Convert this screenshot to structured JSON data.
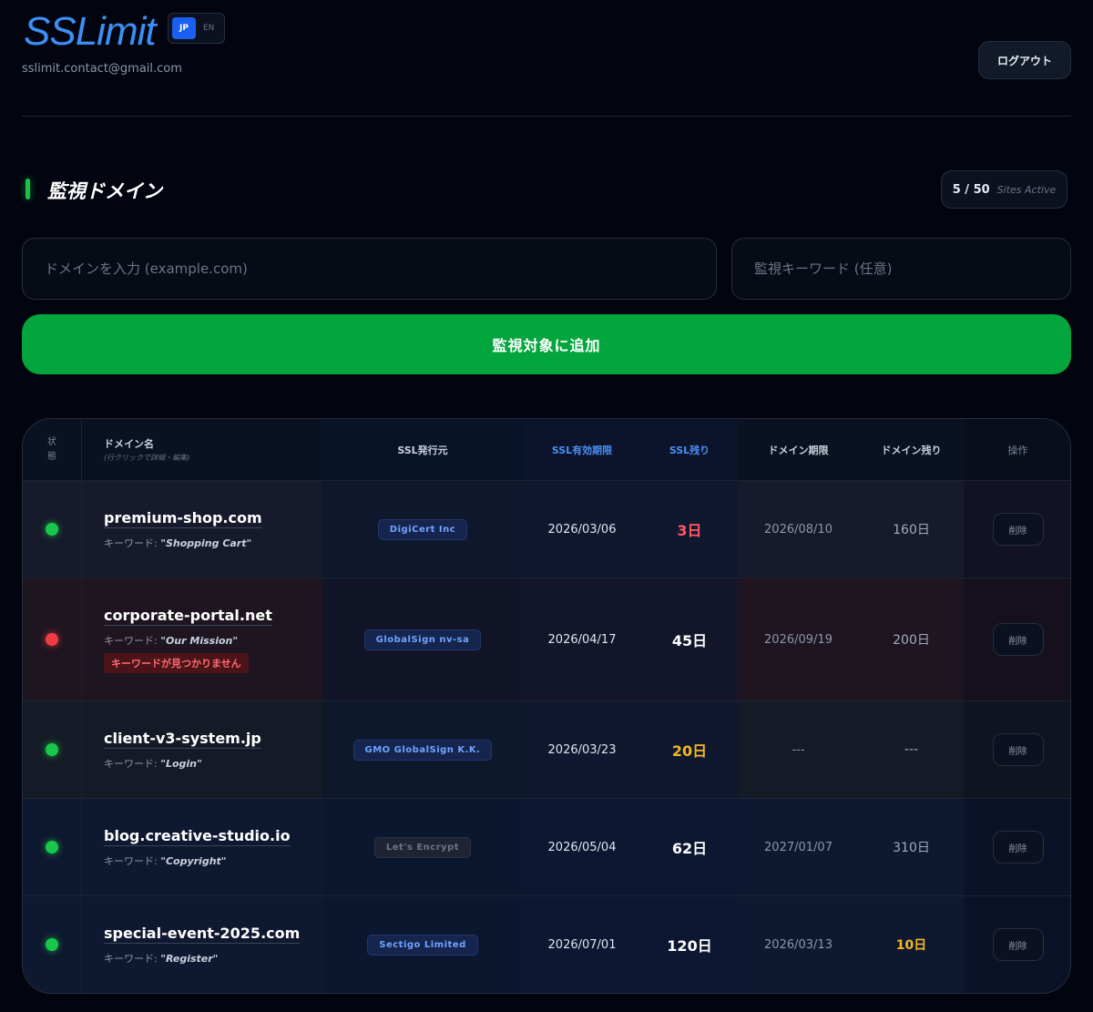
{
  "header": {
    "logo": "SSLimit",
    "lang": {
      "jp": "JP",
      "en": "EN"
    },
    "email": "sslimit.contact@gmail.com",
    "logout_label": "ログアウト"
  },
  "section": {
    "title": "監視ドメイン",
    "sites_count": "5 / 50",
    "sites_label": "Sites Active"
  },
  "form": {
    "domain_placeholder": "ドメインを入力 (example.com)",
    "keyword_placeholder": "監視キーワード (任意)",
    "add_label": "監視対象に追加"
  },
  "table": {
    "headers": {
      "status_1": "状",
      "status_2": "態",
      "domain": "ドメイン名",
      "domain_sub": "(行クリックで詳細・編集)",
      "issuer": "SSL発行元",
      "ssl_expiry": "SSL有効期限",
      "ssl_remaining": "SSL残り",
      "domain_expiry": "ドメイン期限",
      "domain_remaining": "ドメイン残り",
      "ops": "操作"
    },
    "keyword_prefix": "キーワード:",
    "delete_label": "削除",
    "rows": [
      {
        "domain": "premium-shop.com",
        "keyword": "\"Shopping Cart\"",
        "issuer": "DigiCert Inc",
        "ssl_expiry": "2026/03/06",
        "ssl_remaining": "3日",
        "domain_expiry": "2026/08/10",
        "domain_remaining": "160日",
        "status": "ok"
      },
      {
        "domain": "corporate-portal.net",
        "keyword": "\"Our Mission\"",
        "alert": "キーワードが見つかりません",
        "issuer": "GlobalSign nv-sa",
        "ssl_expiry": "2026/04/17",
        "ssl_remaining": "45日",
        "domain_expiry": "2026/09/19",
        "domain_remaining": "200日",
        "status": "error"
      },
      {
        "domain": "client-v3-system.jp",
        "keyword": "\"Login\"",
        "issuer": "GMO GlobalSign K.K.",
        "ssl_expiry": "2026/03/23",
        "ssl_remaining": "20日",
        "domain_expiry": "---",
        "domain_remaining": "---",
        "status": "ok"
      },
      {
        "domain": "blog.creative-studio.io",
        "keyword": "\"Copyright\"",
        "issuer": "Let's Encrypt",
        "ssl_expiry": "2026/05/04",
        "ssl_remaining": "62日",
        "domain_expiry": "2027/01/07",
        "domain_remaining": "310日",
        "status": "ok"
      },
      {
        "domain": "special-event-2025.com",
        "keyword": "\"Register\"",
        "issuer": "Sectigo Limited",
        "ssl_expiry": "2026/07/01",
        "ssl_remaining": "120日",
        "domain_expiry": "2026/03/13",
        "domain_remaining": "10日",
        "status": "ok"
      }
    ]
  },
  "colors": {
    "accent": "#3b8ff5",
    "ok": "#19c84b",
    "error": "#f03b45",
    "warning": "#f5b821",
    "add_button": "#02a63d"
  }
}
